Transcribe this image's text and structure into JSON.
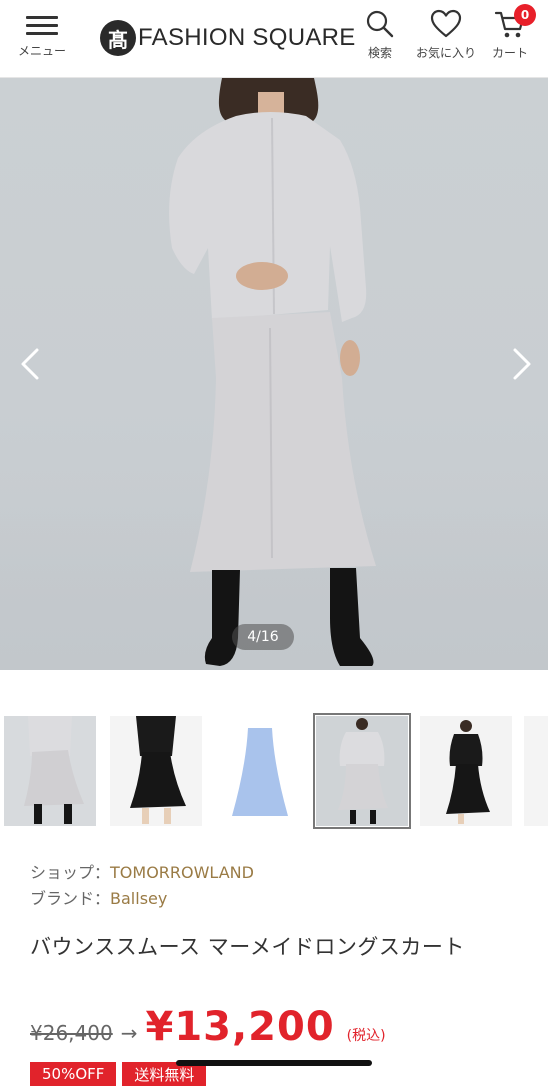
{
  "header": {
    "menu_label": "メニュー",
    "logo_mark": "髙",
    "logo_text": "FASHION SQUARE",
    "search_label": "検索",
    "favorites_label": "お気に入り",
    "cart_label": "カート",
    "cart_count": "0"
  },
  "gallery": {
    "counter": "4/16",
    "selected_thumbnail": 4
  },
  "product": {
    "shop_label": "ショップ：",
    "shop_name": "TOMORROWLAND",
    "brand_label": "ブランド：",
    "brand_name": "Ballsey",
    "title": "バウンススムース マーメイドロングスカート",
    "old_price": "¥26,400",
    "arrow": "→",
    "new_price": "¥13,200",
    "tax_note": "(税込)",
    "badges": [
      "50%OFF",
      "送料無料"
    ]
  },
  "colors": {
    "accent_red": "#e1232b",
    "badge_red": "#e8202a",
    "brand_gold": "#9a7b45"
  }
}
